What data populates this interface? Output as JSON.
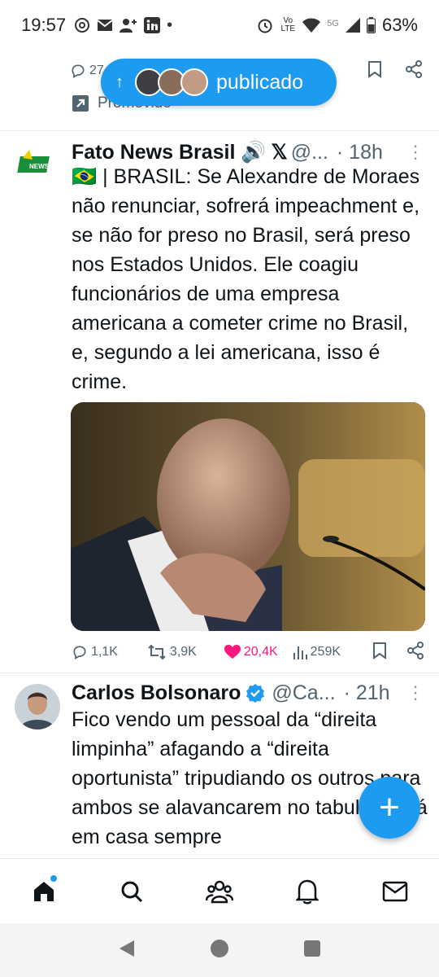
{
  "status_bar": {
    "time": "19:57",
    "battery": "63%",
    "network": "5G",
    "volte": "Vo LTE"
  },
  "previous_tweet": {
    "reply_count": "27",
    "promoted_label": "Promovido"
  },
  "new_posts_pill": {
    "label": "publicado"
  },
  "tweets": [
    {
      "name": "Fato News Brasil 🔊",
      "handle": "@...",
      "time": "· 18h",
      "avatar_text": "NEWS",
      "text": "🇧🇷 | BRASIL: Se Alexandre de Moraes não renunciar, sofrerá impeachment e, se não for preso no Brasil, será preso nos Estados Unidos. Ele coagiu funcionários de uma empresa americana a cometer crime no Brasil, e, segundo a lei americana, isso é crime.",
      "replies": "1,1K",
      "retweets": "3,9K",
      "likes": "20,4K",
      "views": "259K"
    },
    {
      "name": "Carlos Bolsonaro",
      "handle": "@Ca...",
      "time": "· 21h",
      "text": "Fico vendo um pessoal da “direita limpinha” afagando a “direita oportunista” tripudiando os outros para ambos se alavancarem no tabuleiro. Lá em casa sempre"
    }
  ],
  "colors": {
    "accent": "#1d9bf0",
    "like": "#f91880",
    "muted": "#536471"
  },
  "bottom_nav": [
    "home",
    "search",
    "communities",
    "notifications",
    "messages"
  ]
}
